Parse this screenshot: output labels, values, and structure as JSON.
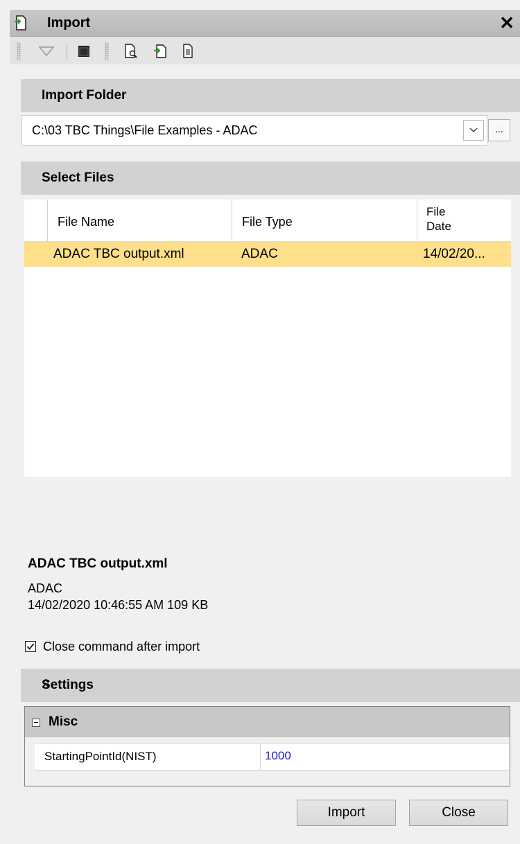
{
  "window": {
    "title": "Import"
  },
  "toolbar": {
    "icons": [
      "filter-icon",
      "terminal-icon",
      "preview-icon",
      "import-icon",
      "document-icon"
    ]
  },
  "import_folder": {
    "header": "Import Folder",
    "path": "C:\\03 TBC Things\\File Examples - ADAC",
    "browse_label": "..."
  },
  "select_files": {
    "header": "Select Files",
    "columns": [
      "File Name",
      "File Type",
      "File\nDate"
    ],
    "rows": [
      {
        "name": "ADAC TBC output.xml",
        "type": "ADAC",
        "date": "14/02/20..."
      }
    ]
  },
  "details": {
    "file_name": "ADAC TBC output.xml",
    "file_type": "ADAC",
    "meta": "14/02/2020 10:46:55 AM  109 KB"
  },
  "options": {
    "close_after_import_label": "Close command after import",
    "close_after_import_checked": true
  },
  "settings": {
    "header": "Settings",
    "group": "Misc",
    "properties": [
      {
        "name": "StartingPointId(NIST)",
        "value": "1000"
      }
    ]
  },
  "buttons": {
    "import": "Import",
    "close": "Close"
  },
  "colors": {
    "selected_row": "#ffdf89",
    "property_value": "#1a1adb",
    "section_header": "#d2d2d2"
  }
}
